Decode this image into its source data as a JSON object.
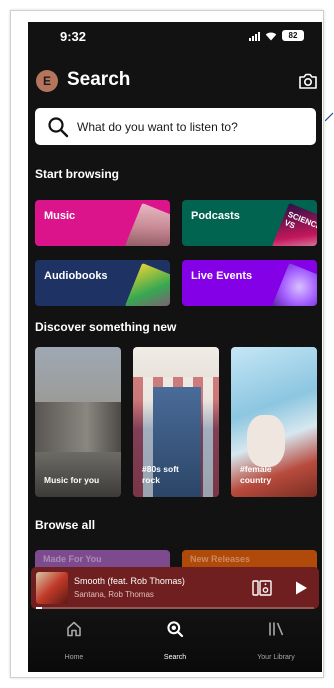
{
  "status_bar": {
    "time": "9:32",
    "battery": "82"
  },
  "header": {
    "avatar_initial": "E",
    "title": "Search"
  },
  "search": {
    "placeholder": "What do you want to listen to?"
  },
  "sections": {
    "start_browsing": "Start browsing",
    "discover": "Discover something new",
    "browse_all": "Browse all"
  },
  "browse_tiles": [
    {
      "label": "Music",
      "color": "#dc148c"
    },
    {
      "label": "Podcasts",
      "color": "#006450"
    },
    {
      "label": "Audiobooks",
      "color": "#1e3264"
    },
    {
      "label": "Live Events",
      "color": "#8400e7"
    }
  ],
  "tile_art_text": "SCIENCE VS",
  "discover_cards": [
    {
      "label": "Music for you"
    },
    {
      "label": "#80s soft rock"
    },
    {
      "label": "#female country"
    }
  ],
  "browse_all_peek": [
    {
      "label": "Made For You",
      "color": "#7d4b8d"
    },
    {
      "label": "New Releases",
      "color": "#b04a0a"
    }
  ],
  "now_playing": {
    "title": "Smooth (feat. Rob Thomas)",
    "artist": "Santana, Rob Thomas",
    "progress": 0.02
  },
  "bottom_nav": [
    {
      "label": "Home",
      "icon": "home-icon",
      "active": false
    },
    {
      "label": "Search",
      "icon": "search-icon",
      "active": true
    },
    {
      "label": "Your Library",
      "icon": "library-icon",
      "active": false
    }
  ],
  "colors": {
    "background": "#121212",
    "player": "#6f1f1f"
  }
}
